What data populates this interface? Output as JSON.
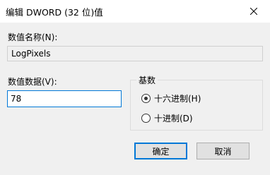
{
  "window": {
    "title": "编辑 DWORD (32 位)值"
  },
  "value_name": {
    "label": "数值名称(N):",
    "value": "LogPixels"
  },
  "value_data": {
    "label": "数值数据(V):",
    "value": "78"
  },
  "base": {
    "legend": "基数",
    "options": [
      {
        "label": "十六进制(H)",
        "checked": true
      },
      {
        "label": "十进制(D)",
        "checked": false
      }
    ]
  },
  "buttons": {
    "ok_label": "确定",
    "cancel_label": "取消"
  },
  "colors": {
    "focus_border": "#0078d7",
    "dialog_background": "#f0f0f0"
  }
}
